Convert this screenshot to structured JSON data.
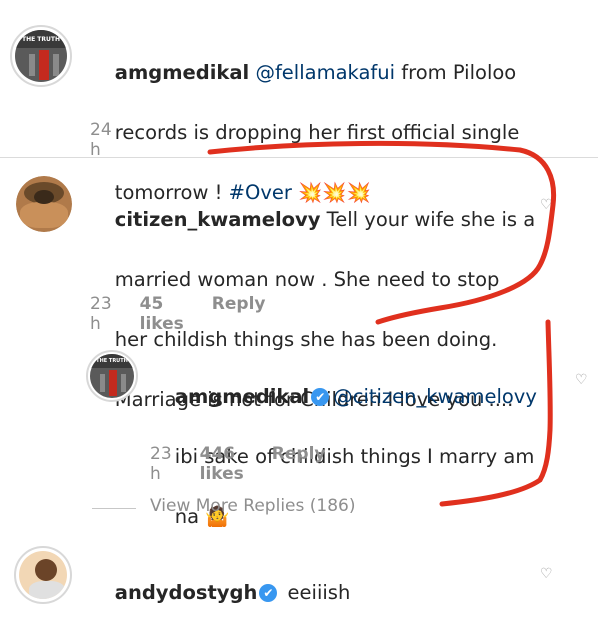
{
  "comments": [
    {
      "username": "amgmedikal",
      "mention": "@fellamakafui",
      "line1_rest": " from Piloloo",
      "line2": "records is dropping her first official single",
      "line3_start": "tomorrow ! ",
      "hashtag": "#Over",
      "emoji": "💥💥💥",
      "time": "24 h"
    },
    {
      "username": "citizen_kwamelovy",
      "line1_rest": " Tell your wife she is a",
      "line2": "married woman now . She need to stop",
      "line3": "her childish things she has been doing.",
      "line4": "Marriage is not for Children I love you ....",
      "time": "23 h",
      "likes": "45 likes",
      "reply": "Reply"
    },
    {
      "username": "amgmedikal",
      "verified": "✔",
      "mention": "@citizen_kwamelovy",
      "line2": "ibi sake of childish things I marry am",
      "line3": "na 🤷",
      "time": "23 h",
      "likes": "446 likes",
      "reply": "Reply"
    },
    {
      "username": "andydostygh",
      "verified": "✔",
      "text": "eeiiish"
    }
  ],
  "view_more": "View More Replies (186)",
  "avatar_label": "THE TRUTH",
  "colors": {
    "annotation": "#e0301e",
    "link": "#00376b",
    "verified": "#3897f0"
  }
}
